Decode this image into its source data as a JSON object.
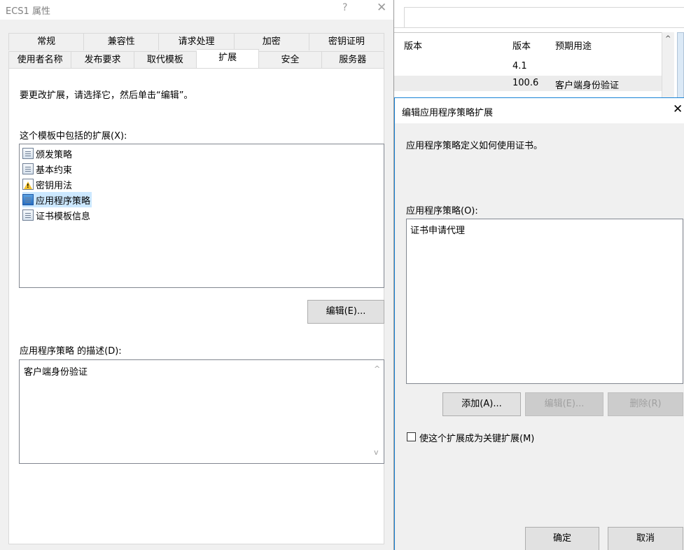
{
  "background_window": {
    "columns": [
      "版本",
      "版本",
      "预期用途"
    ],
    "rows": [
      {
        "version": "4.1",
        "purpose": ""
      },
      {
        "version": "100.6",
        "purpose": "客户端身份验证"
      }
    ],
    "scroll_up_glyph": "^"
  },
  "properties_dialog": {
    "title": "ECS1 属性",
    "help_glyph": "?",
    "close_glyph": "✕",
    "tabs_row1": [
      "常规",
      "兼容性",
      "请求处理",
      "加密",
      "密钥证明"
    ],
    "tabs_row2": [
      "使用者名称",
      "发布要求",
      "取代模板",
      "扩展",
      "安全",
      "服务器"
    ],
    "active_tab": "扩展",
    "instruction": "要更改扩展，请选择它，然后单击“编辑”。",
    "extensions_label": "这个模板中包括的扩展(X):",
    "extensions": [
      {
        "label": "颁发策略",
        "icon": "document-icon"
      },
      {
        "label": "基本约束",
        "icon": "document-icon"
      },
      {
        "label": "密钥用法",
        "icon": "warning-icon"
      },
      {
        "label": "应用程序策略",
        "icon": "document-icon",
        "selected": true
      },
      {
        "label": "证书模板信息",
        "icon": "document-icon"
      }
    ],
    "edit_button": "编辑(E)...",
    "description_label": "应用程序策略 的描述(D):",
    "description_text": "客户端身份验证",
    "scroll_up": "^",
    "scroll_down": "v"
  },
  "edit_dialog": {
    "title": "编辑应用程序策略扩展",
    "close_glyph": "✕",
    "info": "应用程序策略定义如何使用证书。",
    "policies_label": "应用程序策略(O):",
    "policies": [
      "证书申请代理"
    ],
    "add_button": "添加(A)...",
    "edit_button": "编辑(E)...",
    "delete_button": "删除(R)",
    "critical_checkbox_label": "使这个扩展成为关键扩展(M)",
    "critical_checked": false,
    "ok_button": "确定",
    "cancel_button": "取消"
  },
  "colors": {
    "selection": "#cce8ff",
    "dialog_bg": "#f0f0f0",
    "focus_border": "#1883d7"
  }
}
